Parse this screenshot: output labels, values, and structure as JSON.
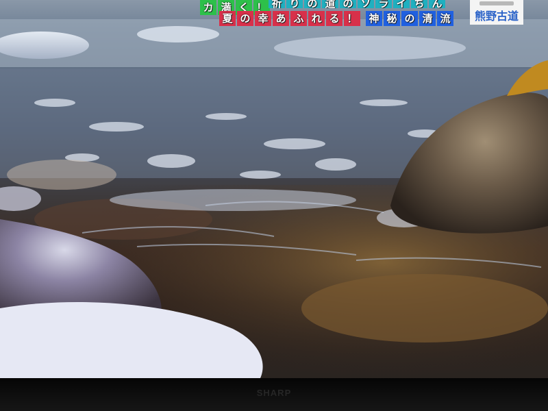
{
  "caption": {
    "line1": [
      "カ",
      "満",
      "く",
      "！",
      "祈",
      "り",
      "の",
      "道",
      "の",
      "ソ",
      "ラ",
      "イ",
      "ち",
      "ん"
    ],
    "line2_red": [
      "夏",
      "の",
      "幸",
      "あ",
      "ふ",
      "れ",
      "る",
      "！"
    ],
    "line2_blue": [
      "神",
      "秘",
      "の",
      "清",
      "流"
    ],
    "place": "熊野古道"
  },
  "tv": {
    "brand": "SHARP"
  },
  "colors": {
    "green": "#2dc04a",
    "red": "#d8304a",
    "blue": "#2060e0",
    "water": "#5d6c80",
    "riverbed": "#3a2a22"
  }
}
